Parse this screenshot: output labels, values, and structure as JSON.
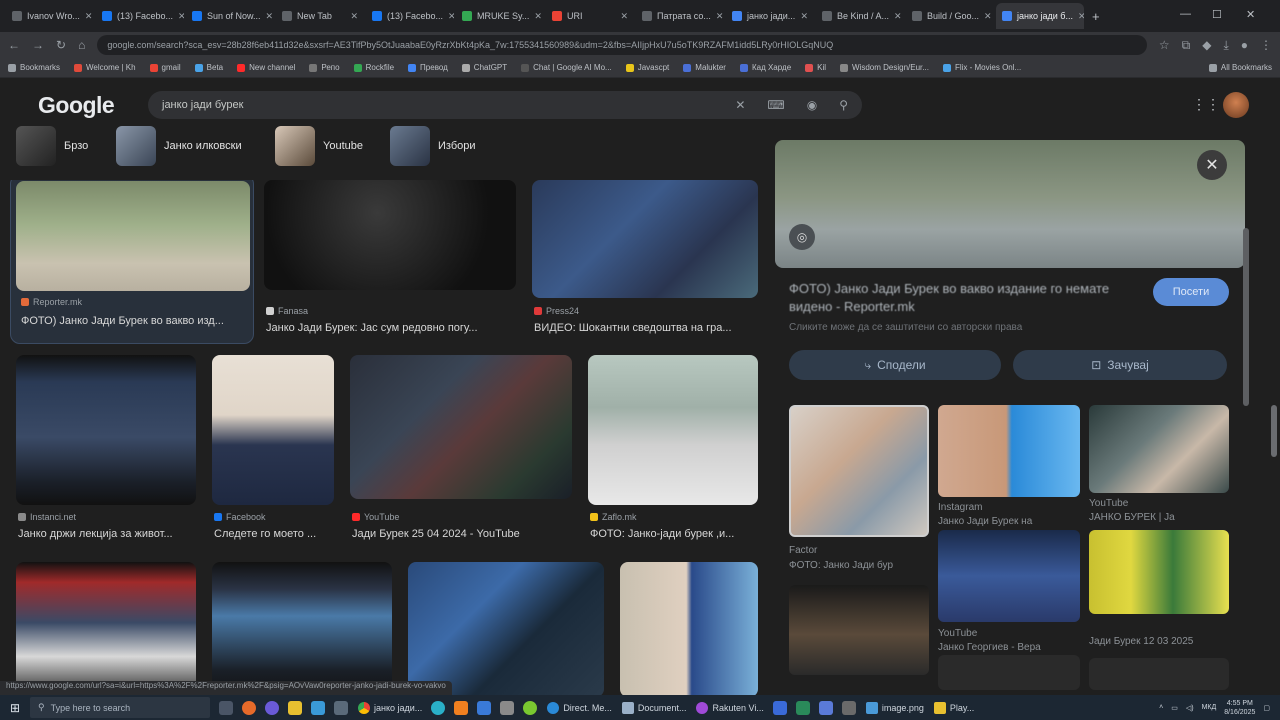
{
  "browser": {
    "tabs": [
      {
        "label": "Ivanov Wro...",
        "color": "#5f6368",
        "active": false
      },
      {
        "label": "(13) Facebo...",
        "color": "#1877f2",
        "active": false
      },
      {
        "label": "Sun of Now...",
        "color": "#1877f2",
        "active": false
      },
      {
        "label": "New Tab",
        "color": "#5f6368",
        "active": false
      },
      {
        "label": "(13) Facebo...",
        "color": "#1877f2",
        "active": false
      },
      {
        "label": "MRUKE Sy...",
        "color": "#34a853",
        "active": false
      },
      {
        "label": "URI",
        "color": "#ea4335",
        "active": false
      },
      {
        "label": "Патрата со...",
        "color": "#5f6368",
        "active": false
      },
      {
        "label": "јанко јади...",
        "color": "#4285f4",
        "active": false
      },
      {
        "label": "Be Kind / A...",
        "color": "#5f6368",
        "active": false
      },
      {
        "label": "Build / Goo...",
        "color": "#5f6368",
        "active": false
      },
      {
        "label": "јанко јади б...",
        "color": "#4285f4",
        "active": true
      }
    ],
    "url": "google.com/search?sca_esv=28b28f6eb411d32e&sxsrf=AE3TifPby5OtJuaabaE0yRzrXbKt4pKa_7w:1755341560989&udm=2&fbs=AIIjpHxU7u5oTK9RZAFM1idd5LRy0rHIOLGqNUQ",
    "bookmarks": [
      "Bookmarks",
      "Welcome | Kh",
      "gmail",
      "Beta",
      "New channel",
      "Репо",
      "Rockfile",
      "Превод",
      "ChatGPT",
      "Chat | Google AI Mo...",
      "Javascpt",
      "Malukter",
      "Кад Харде",
      "Kil",
      "Wisdom Design/Eur...",
      "Flix - Movies Onl...",
      "All Bookmarks"
    ]
  },
  "google": {
    "logo": "Google",
    "query": "јанко јади бурек",
    "chips": [
      {
        "label": "Брзо",
        "color": "#3a3a3a"
      },
      {
        "label": "Јанко илковски",
        "color": "#4a5566"
      },
      {
        "label": "Youtube",
        "color": "#7a6a5a"
      },
      {
        "label": "Избори",
        "color": "#3d4a5c"
      }
    ]
  },
  "results": [
    {
      "source": "Reporter.mk",
      "caption": "ФОТО) Јанко Јади Бурек во вакво изд...",
      "icon_color": "#e36a3a",
      "selected": true
    },
    {
      "source": "Fanasa",
      "caption": "Јанко Јади Бурек: Јас сум редовно погу...",
      "icon_color": "#d0d0d0",
      "selected": false
    },
    {
      "source": "Press24",
      "caption": "ВИДЕО: Шокантни сведоштва на гра...",
      "icon_color": "#e03a3a",
      "selected": false
    },
    {
      "source": "Instanci.net",
      "caption": "Јанко држи лекција за живот...",
      "icon_color": "#8a8a8a",
      "selected": false
    },
    {
      "source": "Facebook",
      "caption": "Следете го моето ...",
      "icon_color": "#1877f2",
      "selected": false
    },
    {
      "source": "YouTube",
      "caption": "Јади Бурек 25 04 2024 - YouTube",
      "icon_color": "#ff2a2a",
      "selected": false
    },
    {
      "source": "Zaflo.mk",
      "caption": "ФОТО: Јанко-јади бурек ,и...",
      "icon_color": "#f2c21a",
      "selected": false
    },
    {
      "source": "",
      "caption": "",
      "icon_color": "#000",
      "selected": false
    },
    {
      "source": "",
      "caption": "",
      "icon_color": "#000",
      "selected": false
    },
    {
      "source": "",
      "caption": "",
      "icon_color": "#000",
      "selected": false
    },
    {
      "source": "",
      "caption": "",
      "icon_color": "#000",
      "selected": false
    }
  ],
  "panel": {
    "title": "ФОТО) Јанко Јади Бурек во вакво издание го немате видено - Reporter.mk",
    "visit_label": "Посети",
    "meta": "Сликите може да се заштитени со авторски права",
    "share_label": "Сподели",
    "save_label": "Зачувај",
    "related": [
      {
        "caption": "Factor",
        "sub": "ФОТО: Јанко Јади бур"
      },
      {
        "caption": "Instagram",
        "sub": "Јанко Јади Бурек на"
      },
      {
        "caption": "YouTube",
        "sub": "ЈАНКО БУРЕК | Ја"
      },
      {
        "caption": "YouTube",
        "sub": "Јанко Георгиев - Вера"
      },
      {
        "caption": "",
        "sub": "Јади Бурек 12 03 2025"
      }
    ]
  },
  "status_url": "https://www.google.com/url?sa=i&url=https%3A%2F%2Freporter.mk%2F&psig=AOvVaw0reporter-janko-jadi-burek-vo-vakvo",
  "taskbar": {
    "search_placeholder": "Type here to search",
    "apps": [
      "јанко јади...",
      "Direct. Ме...",
      "Document...",
      "Rakuten Vi...",
      "image.png",
      "Play..."
    ],
    "lang": "МКД",
    "time": "4:55 PM",
    "date": "8/16/2025"
  }
}
